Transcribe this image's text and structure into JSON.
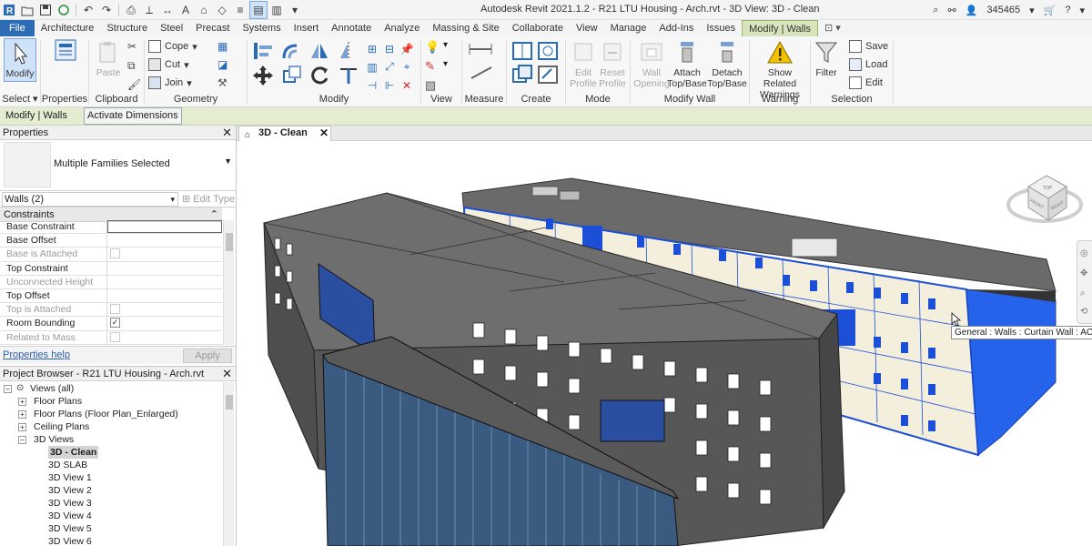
{
  "app": {
    "title": "Autodesk Revit 2021.1.2 - R21 LTU Housing - Arch.rvt - 3D View: 3D - Clean",
    "user": "345465"
  },
  "tabs": [
    "File",
    "Architecture",
    "Structure",
    "Steel",
    "Precast",
    "Systems",
    "Insert",
    "Annotate",
    "Analyze",
    "Massing & Site",
    "Collaborate",
    "View",
    "Manage",
    "Add-Ins",
    "Issues",
    "Modify | Walls"
  ],
  "ribbon": {
    "select": {
      "modify": "Modify",
      "label": "Select"
    },
    "properties": {
      "btn": "Properties",
      "label": "Properties"
    },
    "clipboard": {
      "paste": "Paste",
      "label": "Clipboard"
    },
    "geometry": {
      "cope": "Cope",
      "cut": "Cut",
      "join": "Join",
      "label": "Geometry"
    },
    "modify_label": "Modify",
    "view_label": "View",
    "measure_label": "Measure",
    "create_label": "Create",
    "mode": {
      "edit_profile": "Edit Profile",
      "reset_profile": "Reset Profile",
      "label": "Mode"
    },
    "modify_wall": {
      "wall_opening": "Wall Opening",
      "attach": "Attach Top/Base",
      "detach": "Detach Top/Base",
      "label": "Modify Wall"
    },
    "warning": {
      "show_related": "Show Related Warnings",
      "label": "Warning"
    },
    "selection": {
      "filter": "Filter",
      "save": "Save",
      "load": "Load",
      "edit": "Edit",
      "label": "Selection"
    }
  },
  "options_bar": {
    "context": "Modify | Walls",
    "activate_dimensions": "Activate Dimensions"
  },
  "properties": {
    "title": "Properties",
    "type_name": "Multiple Families Selected",
    "instance_filter": "Walls (2)",
    "edit_type": "Edit Type",
    "category": "Constraints",
    "rows": [
      {
        "name": "Base Constraint",
        "kind": "box"
      },
      {
        "name": "Base Offset",
        "kind": "empty"
      },
      {
        "name": "Base is Attached",
        "kind": "check-grey"
      },
      {
        "name": "Top Constraint",
        "kind": "empty"
      },
      {
        "name": "Unconnected Height",
        "kind": "grey"
      },
      {
        "name": "Top Offset",
        "kind": "empty"
      },
      {
        "name": "Top is Attached",
        "kind": "check-grey"
      },
      {
        "name": "Room Bounding",
        "kind": "check-on"
      },
      {
        "name": "Related to Mass",
        "kind": "check-grey"
      }
    ],
    "help_link": "Properties help",
    "apply": "Apply"
  },
  "browser": {
    "title": "Project Browser - R21 LTU Housing - Arch.rvt",
    "nodes": [
      {
        "label": "Views (all)",
        "level": 0,
        "exp": "−"
      },
      {
        "label": "Floor Plans",
        "level": 1,
        "exp": "+"
      },
      {
        "label": "Floor Plans (Floor Plan_Enlarged)",
        "level": 1,
        "exp": "+"
      },
      {
        "label": "Ceiling Plans",
        "level": 1,
        "exp": "+"
      },
      {
        "label": "3D Views",
        "level": 1,
        "exp": "−"
      },
      {
        "label": "3D - Clean",
        "level": 2,
        "sel": true
      },
      {
        "label": "3D SLAB",
        "level": 2
      },
      {
        "label": "3D View 1",
        "level": 2
      },
      {
        "label": "3D View 2",
        "level": 2
      },
      {
        "label": "3D View 3",
        "level": 2
      },
      {
        "label": "3D View 4",
        "level": 2
      },
      {
        "label": "3D View 5",
        "level": 2
      },
      {
        "label": "3D View 6",
        "level": 2
      }
    ]
  },
  "view": {
    "tab_label": "3D - Clean",
    "tooltip": "General : Walls : Curtain Wall : ACM A",
    "viewcube": {
      "top": "TOP",
      "front": "FRONT",
      "right": "RIGHT"
    }
  },
  "colors": {
    "accent": "#2d6db6",
    "context_tab": "#d8e4bc",
    "selection_blue": "#1c4fd8",
    "building_grey": "#575757"
  }
}
